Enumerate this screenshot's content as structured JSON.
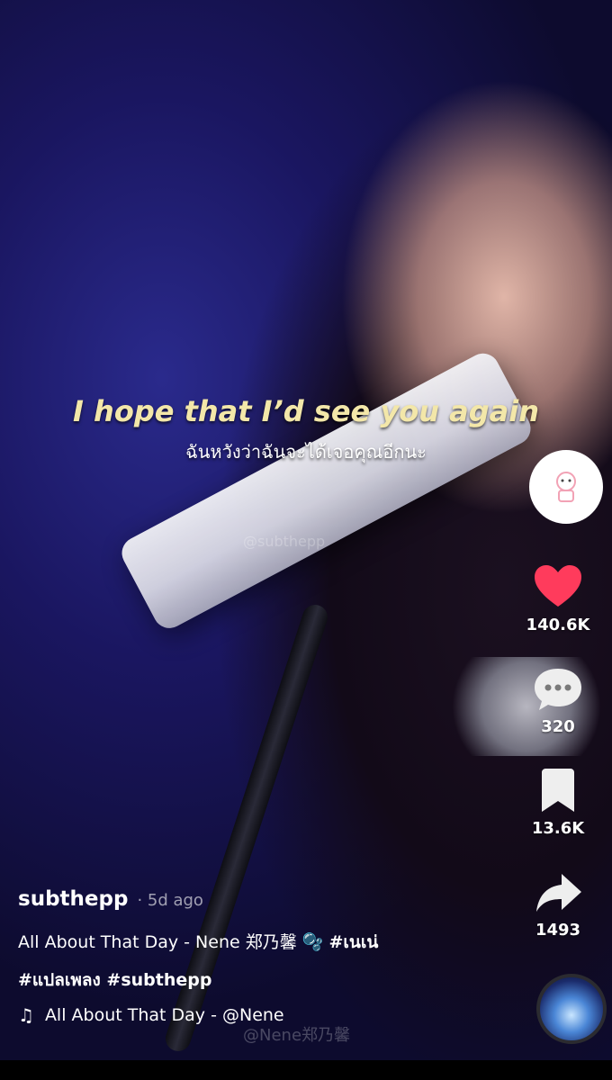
{
  "video": {
    "lyric_en": "I hope that I’d see you again",
    "lyric_th": "ฉันหวังว่าฉันจะได้เจอคุณอีกนะ",
    "watermark": "@subthepp",
    "watermark2": "@Nene郑乃馨"
  },
  "actions": {
    "likes": "140.6K",
    "comments": "320",
    "bookmarks": "13.6K",
    "shares": "1493",
    "like_color": "#ff3b5c"
  },
  "post": {
    "username": "subthepp",
    "time": "· 5d ago",
    "caption_text": "All About That Day - Nene 郑乃馨 🫧",
    "tags_line1": "#เนเน่",
    "tags_line2": "#แปลเพลง #subthepp",
    "music": "All About That Day - @Nene"
  },
  "icons": {
    "avatar": "avatar-icon",
    "like": "heart-icon",
    "comment": "comment-icon",
    "bookmark": "bookmark-icon",
    "share": "share-icon",
    "music": "music-note-icon"
  }
}
